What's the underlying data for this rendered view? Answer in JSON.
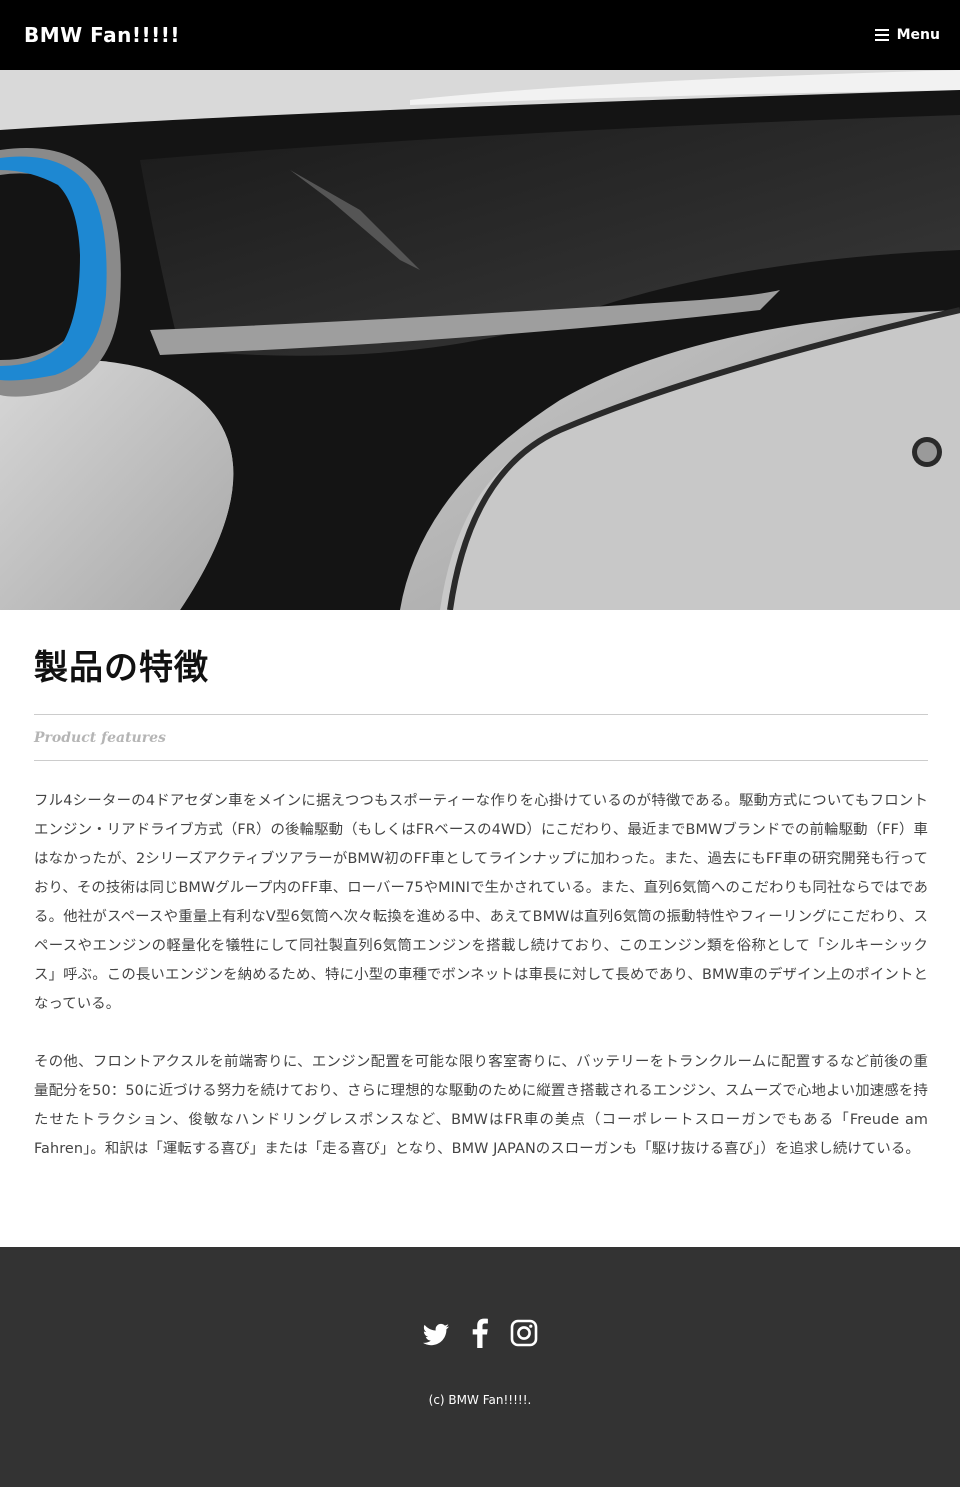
{
  "header": {
    "site_title": "BMW Fan!!!!!",
    "menu_label": "Menu",
    "menu_icon": "hamburger-icon"
  },
  "hero": {
    "image_subject": "BMW i8 front headlight close-up",
    "accent_blue": "#1e88d2"
  },
  "main": {
    "title": "製品の特徴",
    "subtitle": "Product features",
    "paragraphs": [
      "フル4シーターの4ドアセダン車をメインに据えつつもスポーティーな作りを心掛けているのが特徴である。駆動方式についてもフロントエンジン・リアドライブ方式（FR）の後輪駆動（もしくはFRベースの4WD）にこだわり、最近までBMWブランドでの前輪駆動（FF）車はなかったが、2シリーズアクティブツアラーがBMW初のFF車としてラインナップに加わった。また、過去にもFF車の研究開発も行っており、その技術は同じBMWグループ内のFF車、ローバー75やMINIで生かされている。また、直列6気筒へのこだわりも同社ならではである。他社がスペースや重量上有利なV型6気筒へ次々転換を進める中、あえてBMWは直列6気筒の振動特性やフィーリングにこだわり、スペースやエンジンの軽量化を犠牲にして同社製直列6気筒エンジンを搭載し続けており、このエンジン類を俗称として「シルキーシックス」呼ぶ。この長いエンジンを納めるため、特に小型の車種でボンネットは車長に対して長めであり、BMW車のデザイン上のポイントとなっている。",
      "その他、フロントアクスルを前端寄りに、エンジン配置を可能な限り客室寄りに、バッテリーをトランクルームに配置するなど前後の重量配分を50：50に近づける努力を続けており、さらに理想的な駆動のために縦置き搭載されるエンジン、スムーズで心地よい加速感を持たせたトラクション、俊敏なハンドリングレスポンスなど、BMWはFR車の美点（コーポレートスローガンでもある「Freude am Fahren」。和訳は「運転する喜び」または「走る喜び」となり、BMW JAPANのスローガンも「駆け抜ける喜び」）を追求し続けている。"
    ]
  },
  "footer": {
    "social": [
      {
        "name": "twitter-icon"
      },
      {
        "name": "facebook-icon"
      },
      {
        "name": "instagram-icon"
      }
    ],
    "copyright": "(c) BMW Fan!!!!!."
  }
}
